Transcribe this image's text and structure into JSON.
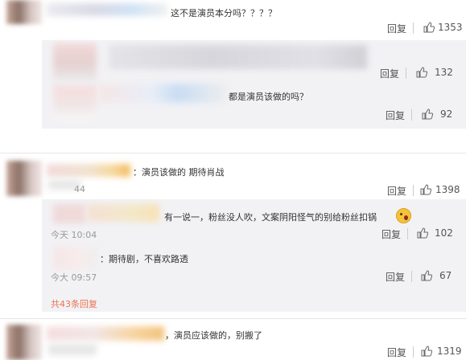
{
  "comments": [
    {
      "text": "这不是演员本分吗？？？？",
      "reply_label": "回复",
      "likes": "1353"
    },
    {
      "reply_label": "回复",
      "likes": "132"
    },
    {
      "text": "都是演员该做的吗？",
      "reply_label": "回复",
      "likes": "92"
    },
    {
      "text": "：演员该做的 期待肖战",
      "time": "44",
      "reply_label": "回复",
      "likes": "1398"
    },
    {
      "text": "有一说一，粉丝没人吹，文案阴阳怪气的别给粉丝扣锅",
      "time": "今天 10:04",
      "reply_label": "回复",
      "likes": "102"
    },
    {
      "text": "：期待剧，不喜欢路透",
      "time": "今大 09:57",
      "reply_label": "回复",
      "likes": "67"
    },
    {
      "text": "，演员应该做的，别搬了",
      "reply_label": "回复",
      "likes": "1319"
    }
  ],
  "more_replies": "共43条回复",
  "colors": {
    "accent": "#eb7350",
    "text": "#333333",
    "meta": "#999999",
    "sub_bg": "#f2f2f5"
  },
  "icons": [
    "thumbs-up-icon",
    "crying-emoji-icon"
  ]
}
